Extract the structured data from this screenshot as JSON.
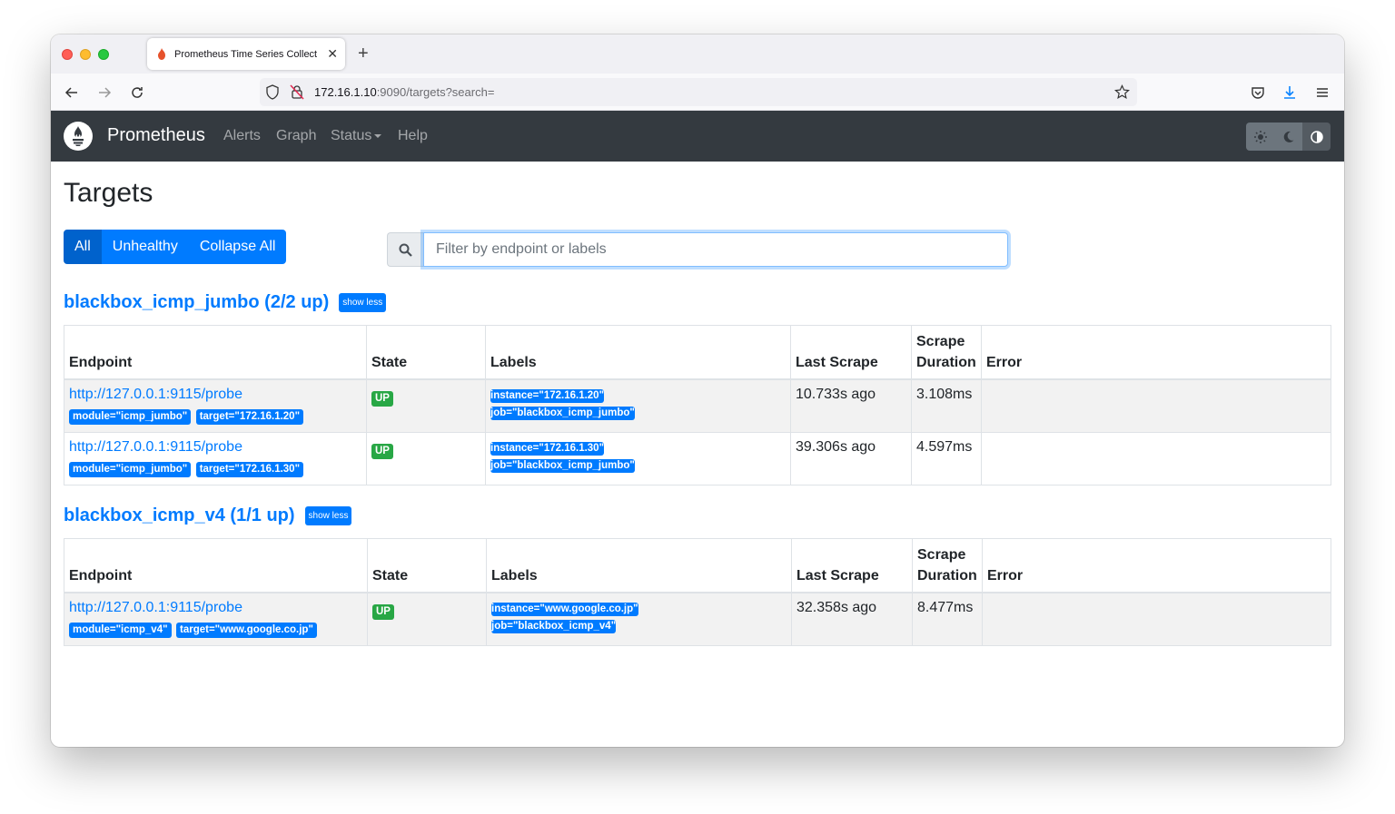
{
  "browser": {
    "tab_title": "Prometheus Time Series Collect",
    "url_host": "172.16.1.10",
    "url_rest": ":9090/targets?search="
  },
  "app": {
    "brand": "Prometheus",
    "nav": [
      "Alerts",
      "Graph",
      "Status",
      "Help"
    ]
  },
  "page": {
    "title": "Targets",
    "filters": [
      "All",
      "Unhealthy",
      "Collapse All"
    ],
    "search_placeholder": "Filter by endpoint or labels",
    "columns": [
      "Endpoint",
      "State",
      "Labels",
      "Last Scrape",
      "Scrape Duration",
      "Error"
    ]
  },
  "groups": [
    {
      "title": "blackbox_icmp_jumbo (2/2 up)",
      "toggle": "show less",
      "rows": [
        {
          "endpoint": "http://127.0.0.1:9115/probe",
          "params": [
            "module=\"icmp_jumbo\"",
            "target=\"172.16.1.20\""
          ],
          "state": "UP",
          "labels": [
            "instance=\"172.16.1.20\"",
            "job=\"blackbox_icmp_jumbo\""
          ],
          "last_scrape": "10.733s ago",
          "duration": "3.108ms",
          "error": ""
        },
        {
          "endpoint": "http://127.0.0.1:9115/probe",
          "params": [
            "module=\"icmp_jumbo\"",
            "target=\"172.16.1.30\""
          ],
          "state": "UP",
          "labels": [
            "instance=\"172.16.1.30\"",
            "job=\"blackbox_icmp_jumbo\""
          ],
          "last_scrape": "39.306s ago",
          "duration": "4.597ms",
          "error": ""
        }
      ]
    },
    {
      "title": "blackbox_icmp_v4 (1/1 up)",
      "toggle": "show less",
      "rows": [
        {
          "endpoint": "http://127.0.0.1:9115/probe",
          "params": [
            "module=\"icmp_v4\"",
            "target=\"www.google.co.jp\""
          ],
          "state": "UP",
          "labels": [
            "instance=\"www.google.co.jp\"",
            "job=\"blackbox_icmp_v4\""
          ],
          "last_scrape": "32.358s ago",
          "duration": "8.477ms",
          "error": ""
        }
      ]
    }
  ],
  "colors": {
    "primary": "#007bff",
    "success": "#28a745",
    "navbar": "#343a40"
  },
  "icons": [
    "prometheus-logo-icon",
    "search-icon",
    "sun-icon",
    "moon-icon",
    "contrast-icon",
    "back-icon",
    "forward-icon",
    "reload-icon",
    "shield-icon",
    "star-icon",
    "pocket-icon",
    "download-icon",
    "menu-icon"
  ]
}
